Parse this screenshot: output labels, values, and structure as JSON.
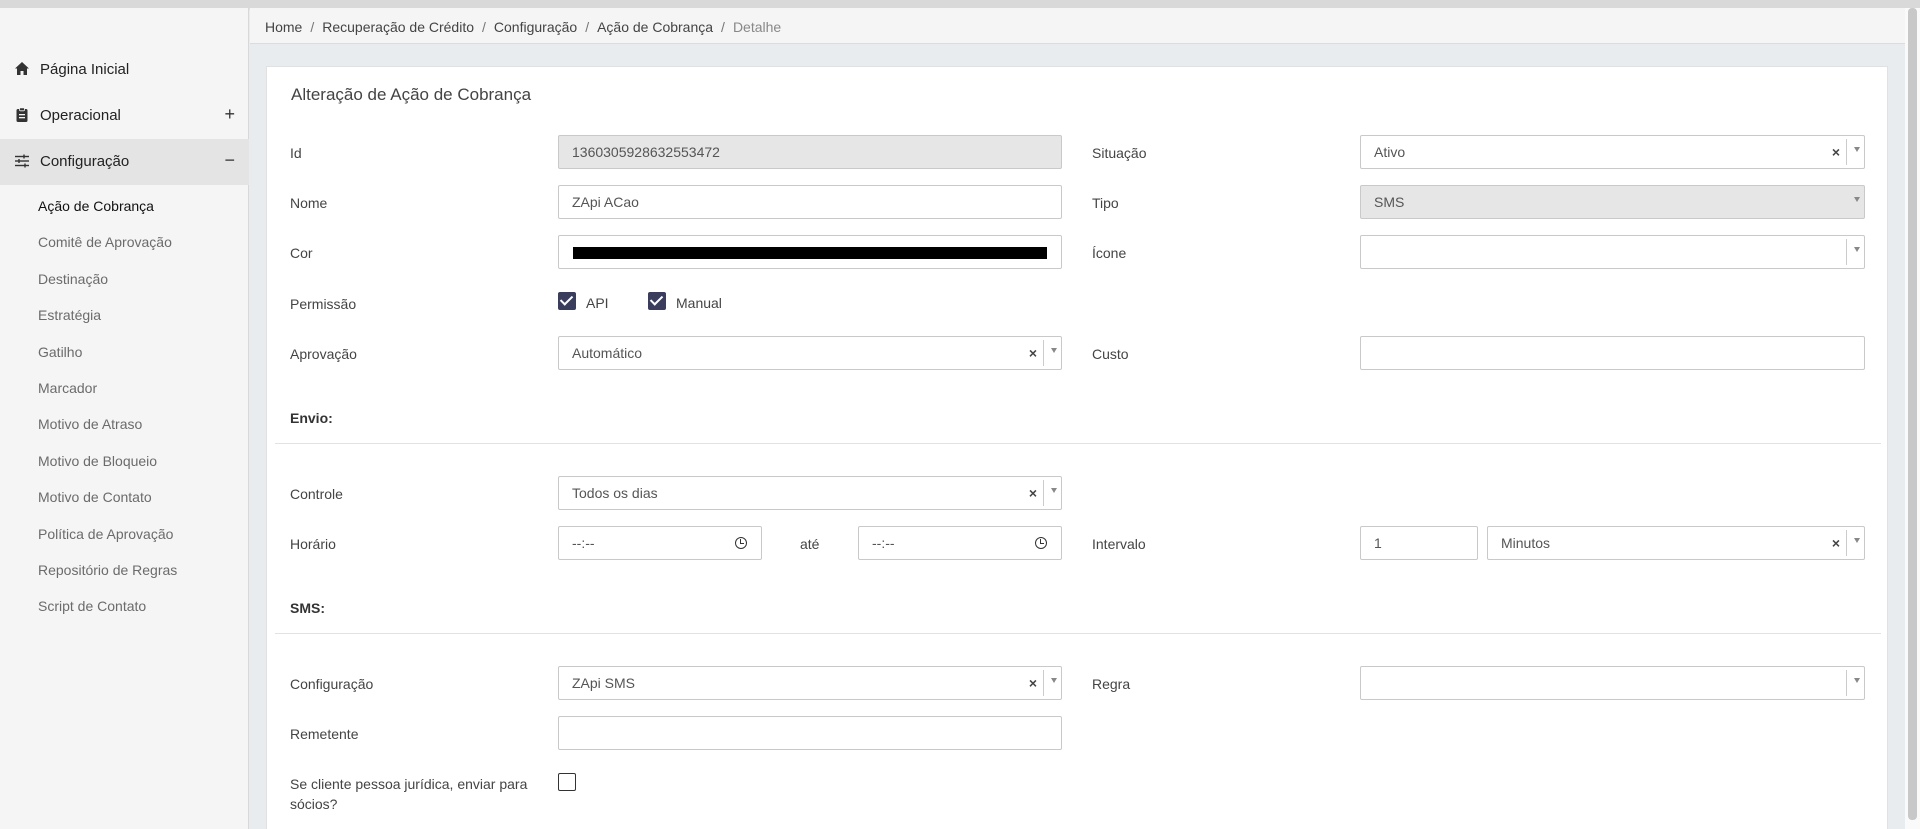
{
  "sidebar": {
    "main_items": [
      {
        "label": "Página Inicial",
        "icon": "home-icon",
        "toggle": ""
      },
      {
        "label": "Operacional",
        "icon": "clipboard-icon",
        "toggle": "+"
      },
      {
        "label": "Configuração",
        "icon": "sliders-icon",
        "toggle": "−"
      }
    ],
    "sub_items": [
      {
        "label": "Ação de Cobrança",
        "active": true
      },
      {
        "label": "Comitê de Aprovação"
      },
      {
        "label": "Destinação"
      },
      {
        "label": "Estratégia"
      },
      {
        "label": "Gatilho"
      },
      {
        "label": "Marcador"
      },
      {
        "label": "Motivo de Atraso"
      },
      {
        "label": "Motivo de Bloqueio"
      },
      {
        "label": "Motivo de Contato"
      },
      {
        "label": "Política de Aprovação"
      },
      {
        "label": "Repositório de Regras"
      },
      {
        "label": "Script de Contato"
      }
    ]
  },
  "breadcrumb": {
    "items": [
      "Home",
      "Recuperação de Crédito",
      "Configuração",
      "Ação de Cobrança"
    ],
    "current": "Detalhe",
    "separator": "/"
  },
  "form": {
    "title": "Alteração de Ação de Cobrança",
    "id": {
      "label": "Id",
      "value": "1360305928632553472"
    },
    "situacao": {
      "label": "Situação",
      "value": "Ativo"
    },
    "nome": {
      "label": "Nome",
      "value": "ZApi ACao"
    },
    "tipo": {
      "label": "Tipo",
      "value": "SMS"
    },
    "cor": {
      "label": "Cor",
      "value": "#000000"
    },
    "icone": {
      "label": "Ícone",
      "value": ""
    },
    "permissao": {
      "label": "Permissão",
      "options": [
        {
          "label": "API",
          "checked": true
        },
        {
          "label": "Manual",
          "checked": true
        }
      ]
    },
    "aprovacao": {
      "label": "Aprovação",
      "value": "Automático"
    },
    "custo": {
      "label": "Custo",
      "value": ""
    },
    "envio": {
      "section_label": "Envio:",
      "controle": {
        "label": "Controle",
        "value": "Todos os dias"
      },
      "horario": {
        "label": "Horário",
        "from": "--:--",
        "to_label": "até",
        "to": "--:--"
      },
      "intervalo": {
        "label": "Intervalo",
        "value": "1",
        "unit": "Minutos"
      }
    },
    "sms": {
      "section_label": "SMS:",
      "configuracao": {
        "label": "Configuração",
        "value": "ZApi SMS"
      },
      "regra": {
        "label": "Regra",
        "value": ""
      },
      "remetente": {
        "label": "Remetente",
        "value": ""
      },
      "socios": {
        "label_line1": "Se cliente pessoa jurídica, enviar para",
        "label_line2": "sócios?",
        "checked": false
      }
    }
  },
  "colors": {
    "accent": "#3a3d5c",
    "sidebar_active": "#e4e4e4"
  }
}
